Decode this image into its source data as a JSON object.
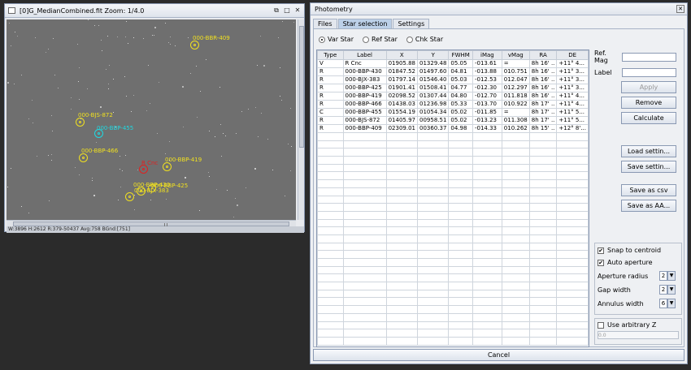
{
  "image_window": {
    "title": "[0]G_MedianCombined.fit  Zoom: 1/4.0",
    "status": "W:3896 H:2612 R:379-50437 Avg:758 BGnd:[751]",
    "annotations": [
      {
        "label": "000-BBR-409",
        "color": "#f0e020"
      },
      {
        "label": "000-BJS-872",
        "color": "#f0e020"
      },
      {
        "label": "000-BBP-455",
        "color": "#20d8e0"
      },
      {
        "label": "000-BBP-466",
        "color": "#f0e020"
      },
      {
        "label": "R Cnc",
        "color": "#e02020"
      },
      {
        "label": "000-BBP-419",
        "color": "#f0e020"
      },
      {
        "label": "000-BBP-430",
        "color": "#f0e020"
      },
      {
        "label": "000-BBP-425",
        "color": "#f0e020"
      },
      {
        "label": "000-BJX-383",
        "color": "#f0e020"
      }
    ]
  },
  "photometry": {
    "title": "Photometry",
    "tabs": [
      "Files",
      "Star selection",
      "Settings"
    ],
    "active_tab": "Star selection",
    "radios": [
      "Var Star",
      "Ref Star",
      "Chk Star"
    ],
    "selected_radio": "Var Star",
    "columns": [
      "Type",
      "Label",
      "X",
      "Y",
      "FWHM",
      "iMag",
      "vMag",
      "RA",
      "DE"
    ],
    "rows": [
      [
        "V",
        "R Cnc",
        "01905.88",
        "01329.48",
        "05.05",
        "-013.61",
        "=",
        "8h 16' ..",
        "+11° 4..."
      ],
      [
        "R",
        "000-BBP-430",
        "01847.52",
        "01497.60",
        "04.81",
        "-013.88",
        "010.751",
        "8h 16' ..",
        "+11° 3..."
      ],
      [
        "R",
        "000-BJX-383",
        "01797.14",
        "01546.40",
        "05.03",
        "-012.53",
        "012.047",
        "8h 16' ..",
        "+11° 3..."
      ],
      [
        "R",
        "000-BBP-425",
        "01901.41",
        "01508.41",
        "04.77",
        "-012.30",
        "012.297",
        "8h 16' ..",
        "+11° 3..."
      ],
      [
        "R",
        "000-BBP-419",
        "02098.52",
        "01307.44",
        "04.80",
        "-012.70",
        "011.818",
        "8h 16' ..",
        "+11° 4..."
      ],
      [
        "R",
        "000-BBP-466",
        "01438.03",
        "01236.98",
        "05.33",
        "-013.70",
        "010.922",
        "8h 17' ..",
        "+11° 4..."
      ],
      [
        "C",
        "000-BBP-455",
        "01554.19",
        "01054.34",
        "05.02",
        "-011.85",
        "=",
        "8h 17' ..",
        "+11° 5..."
      ],
      [
        "R",
        "000-BJS-872",
        "01405.97",
        "00958.51",
        "05.02",
        "-013.23",
        "011.308",
        "8h 17' ..",
        "+11° 5..."
      ],
      [
        "R",
        "000-BBP-409",
        "02309.01",
        "00360.37",
        "04.98",
        "-014.33",
        "010.262",
        "8h 15' ..",
        "+12° 8'..."
      ]
    ],
    "side": {
      "ref_mag_label": "Ref. Mag",
      "label_label": "Label",
      "apply": "Apply",
      "remove": "Remove",
      "calculate": "Calculate",
      "load_settings": "Load settin...",
      "save_settings": "Save settin...",
      "save_csv": "Save as csv",
      "save_aa": "Save as AA...",
      "snap": "Snap to centroid",
      "auto_aperture": "Auto aperture",
      "aperture_radius_label": "Aperture radius",
      "aperture_radius": "2",
      "gap_width_label": "Gap width",
      "gap_width": "2",
      "annulus_width_label": "Annulus width",
      "annulus_width": "6",
      "use_z": "Use arbitrary Z",
      "z_value": "0.0"
    },
    "cancel": "Cancel"
  }
}
